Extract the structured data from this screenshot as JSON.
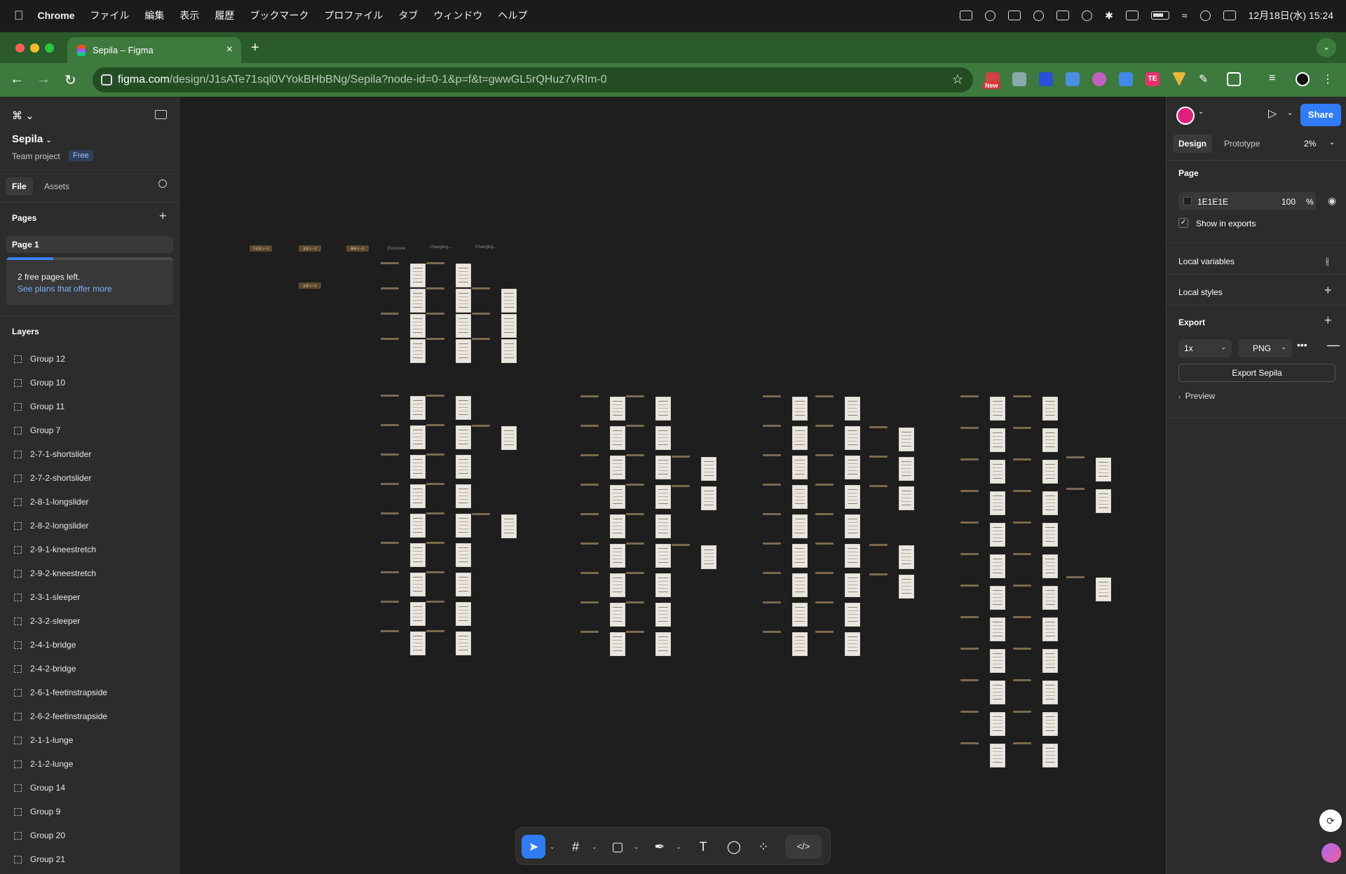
{
  "menubar": {
    "app": "Chrome",
    "items": [
      "ファイル",
      "編集",
      "表示",
      "履歴",
      "ブックマーク",
      "プロファイル",
      "タブ",
      "ウィンドウ",
      "ヘルプ"
    ],
    "clock": "12月18日(水)  15:24"
  },
  "browser": {
    "tab_title": "Sepila – Figma",
    "url_host": "figma.com",
    "url_path": "/design/J1sATe71sql0VYokBHbBNg/Sepila?node-id=0-1&p=f&t=gwwGL5rQHuz7vRIm-0",
    "new_badge": "New",
    "te_badge": "TE"
  },
  "left_panel": {
    "project_name": "Sepila",
    "team": "Team project",
    "plan_badge": "Free",
    "tab_file": "File",
    "tab_assets": "Assets",
    "pages_title": "Pages",
    "page_name": "Page 1",
    "free_pages_text": "2 free pages left.",
    "free_pages_link": "See plans that offer more",
    "free_pages_used": 0.28,
    "layers_title": "Layers",
    "layers": [
      "Group 12",
      "Group 10",
      "Group 11",
      "Group 7",
      "2-7-1-shortslider",
      "2-7-2-shortslider",
      "2-8-1-longslider",
      "2-8-2-longslider",
      "2-9-1-kneestretch",
      "2-9-2-kneestretch",
      "2-3-1-sleeper",
      "2-3-2-sleeper",
      "2-4-1-bridge",
      "2-4-2-bridge",
      "2-6-1-feetinstrapside",
      "2-6-2-feetinstrapside",
      "2-1-1-lunge",
      "2-1-2-lunge",
      "Group 14",
      "Group 9",
      "Group 20",
      "Group 21"
    ]
  },
  "canvas": {
    "chips": [
      "下半身コース",
      "全身コース",
      "体幹コース",
      "全身コース"
    ],
    "headers": [
      "Exclusive",
      "Changing...",
      "Changing..."
    ]
  },
  "right_panel": {
    "tab_design": "Design",
    "tab_prototype": "Prototype",
    "zoom": "2%",
    "share": "Share",
    "page_title": "Page",
    "bg_hex": "1E1E1E",
    "bg_opacity": "100",
    "pct": "%",
    "show_in_exports": "Show in exports",
    "local_variables": "Local variables",
    "local_styles": "Local styles",
    "export_title": "Export",
    "export_scale": "1x",
    "export_format": "PNG",
    "export_button": "Export Sepila",
    "preview": "Preview"
  },
  "colors": {
    "accent": "#2f7cf6",
    "canvas_bg": "#1e1e1e",
    "tab_green": "#3e7a3e"
  }
}
